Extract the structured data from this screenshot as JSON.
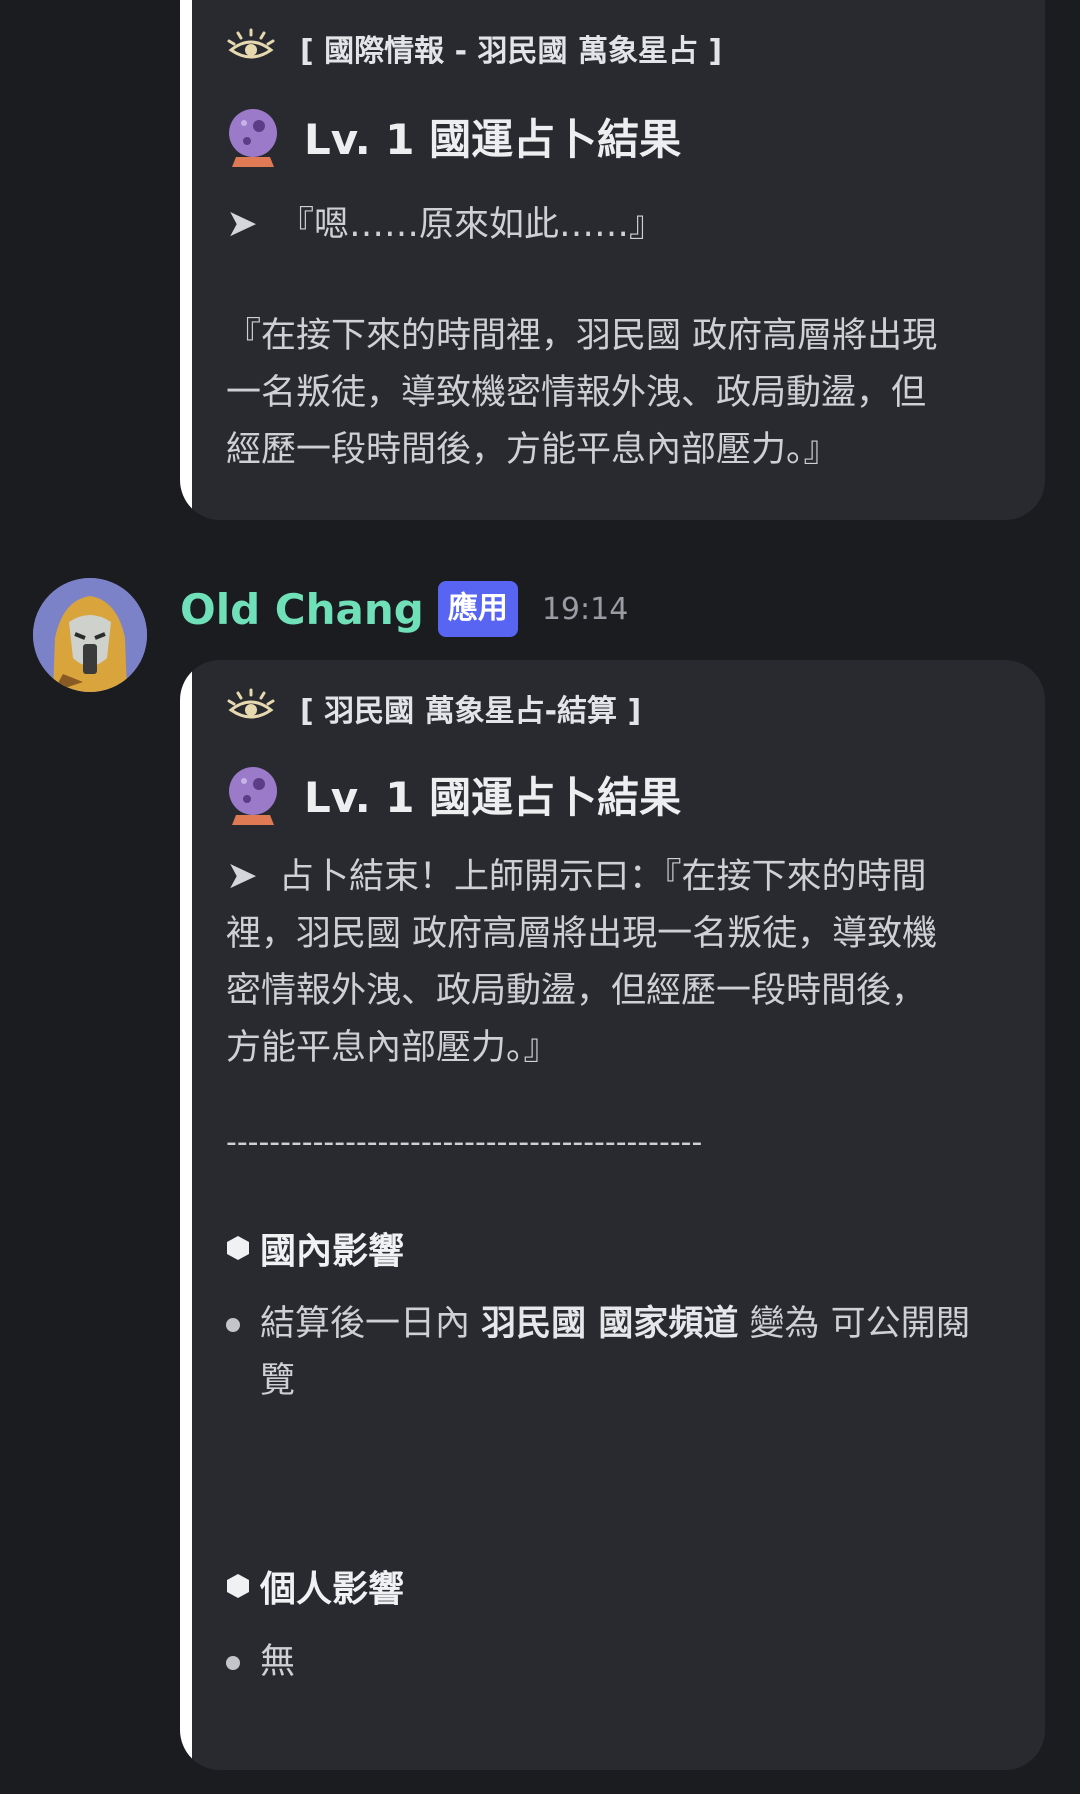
{
  "messages": [
    {
      "embed": {
        "author": "[ 國際情報 - 羽民國 萬象星占 ]",
        "author_icon": "eye-icon",
        "title": "Lv. 1 國運占卜結果",
        "title_icon": "crystal-ball-icon",
        "arrow": "➤",
        "line1": "『嗯……原來如此……』",
        "body": [
          "『在接下來的時間裡，羽民國 政府高層將出現",
          "一名叛徒，導致機密情報外洩、政局動盪，但",
          "經歷一段時間後，方能平息內部壓力。』"
        ]
      }
    },
    {
      "username": "Old Chang",
      "tag": "應用",
      "timestamp": "19:14",
      "embed": {
        "author": "[ 羽民國 萬象星占-結算 ]",
        "author_icon": "eye-icon",
        "title": "Lv. 1 國運占卜結果",
        "title_icon": "crystal-ball-icon",
        "arrow": "➤",
        "desc": [
          " 占卜結束！上師開示曰：『在接下來的時間",
          "裡，羽民國 政府高層將出現一名叛徒，導致機",
          "密情報外洩、政局動盪，但經歷一段時間後，",
          "方能平息內部壓力。』"
        ],
        "divider": "--------------------------------------------",
        "fields": [
          {
            "name": "國內影響",
            "bullet": {
              "pre": "結算後一日內 ",
              "bold": "羽民國 國家頻道",
              "post1": " 變為 可公開閱",
              "post2": "覽"
            }
          },
          {
            "name": "個人影響",
            "bullet_text": "無"
          }
        ]
      }
    }
  ],
  "colors": {
    "background": "#1b1c20",
    "embed_bg": "#282a2f",
    "embed_bar": "#ffffff",
    "username": "#6fe0b8",
    "app_tag": "#5865f2"
  }
}
